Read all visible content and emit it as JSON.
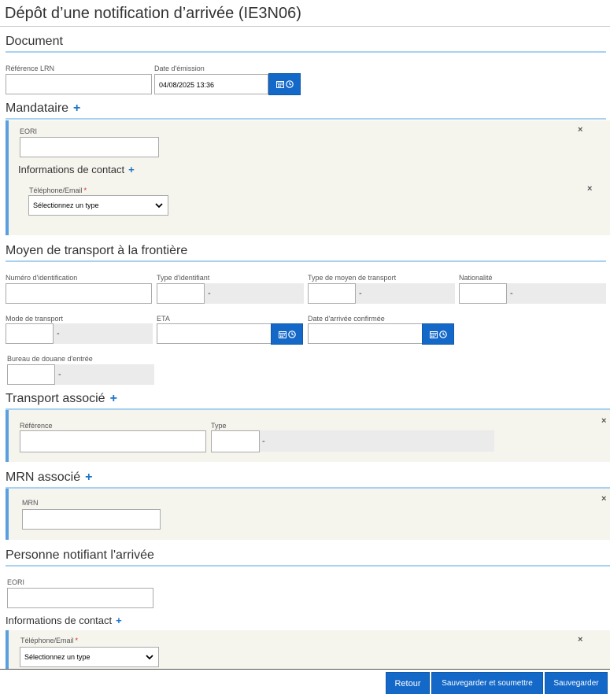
{
  "page": {
    "title": "Dépôt d’une notification d’arrivée (IE3N06)"
  },
  "document": {
    "heading": "Document",
    "lrn_label": "Référence LRN",
    "lrn_value": "",
    "date_label": "Date d'émission",
    "date_value": "04/08/2025 13:36"
  },
  "mandataire": {
    "heading": "Mandataire",
    "add_symbol": "+",
    "eori_label": "EORI",
    "eori_value": "",
    "contact_heading": "Informations de contact",
    "phone_label": "Téléphone/Email",
    "required_mark": "*",
    "type_select": "Sélectionnez un type",
    "close_symbol": "×"
  },
  "transport": {
    "heading": "Moyen de transport à la frontière",
    "id_number_label": "Numéro d'identification",
    "id_type_label": "Type d'identifiant",
    "means_type_label": "Type de moyen de transport",
    "nationality_label": "Nationalité",
    "mode_label": "Mode de transport",
    "eta_label": "ETA",
    "arrival_label": "Date d'arrivée confirmée",
    "office_label": "Bureau de douane d'entrée",
    "dash": "-"
  },
  "assoc_transport": {
    "heading": "Transport associé",
    "ref_label": "Référence",
    "type_label": "Type",
    "dash": "-",
    "close_symbol": "×"
  },
  "mrn": {
    "heading": "MRN associé",
    "mrn_label": "MRN",
    "close_symbol": "×"
  },
  "notifier": {
    "heading": "Personne notifiant l'arrivée",
    "eori_label": "EORI",
    "contact_heading": "Informations de contact",
    "phone_label": "Téléphone/Email",
    "required_mark": "*",
    "type_select": "Sélectionnez un type",
    "close_symbol": "×"
  },
  "footer": {
    "back": "Retour",
    "save_submit": "Sauvegarder et soumettre",
    "save": "Sauvegarder"
  },
  "colors": {
    "accent": "#1468c8",
    "rule": "#a8d2f0",
    "panel": "#f5f4ed",
    "panel_border": "#5aa0e0",
    "required": "#d9242c"
  },
  "icons": {
    "calendar": "calendar-icon",
    "clock": "clock-icon",
    "chevron": "chevron-down-icon",
    "close": "close-icon"
  }
}
